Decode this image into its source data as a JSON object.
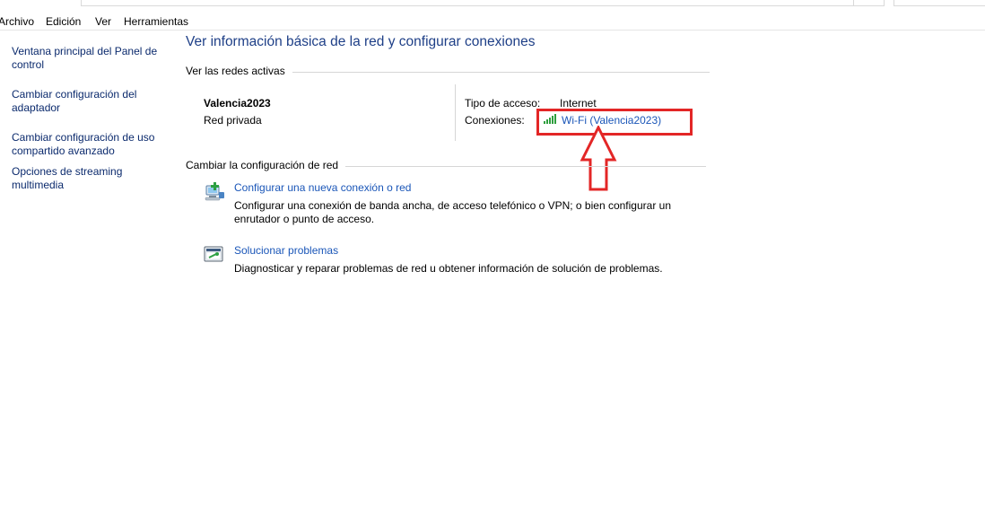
{
  "menubar": {
    "items": [
      "Archivo",
      "Edición",
      "Ver",
      "Herramientas"
    ]
  },
  "sidebar": {
    "items": [
      {
        "label": "Ventana principal del Panel de control"
      },
      {
        "label": "Cambiar configuración del adaptador"
      },
      {
        "label": "Cambiar configuración de uso compartido avanzado"
      },
      {
        "label": "Opciones de streaming multimedia"
      }
    ]
  },
  "main": {
    "title": "Ver información básica de la red y configurar conexiones",
    "active_networks": {
      "heading": "Ver las redes activas",
      "network_name": "Valencia2023",
      "network_type": "Red privada",
      "access_label": "Tipo de acceso:",
      "access_value": "Internet",
      "connections_label": "Conexiones:",
      "connection_link": "Wi-Fi (Valencia2023)"
    },
    "change_settings": {
      "heading": "Cambiar la configuración de red",
      "tasks": [
        {
          "link": "Configurar una nueva conexión o red",
          "description": "Configurar una conexión de banda ancha, de acceso telefónico o VPN; o bien configurar un enrutador o punto de acceso.",
          "icon": "new-connection-icon"
        },
        {
          "link": "Solucionar problemas",
          "description": "Diagnosticar y reparar problemas de red u obtener información de solución de problemas.",
          "icon": "troubleshoot-icon"
        }
      ]
    }
  },
  "annotation": {
    "color": "#e32626"
  }
}
